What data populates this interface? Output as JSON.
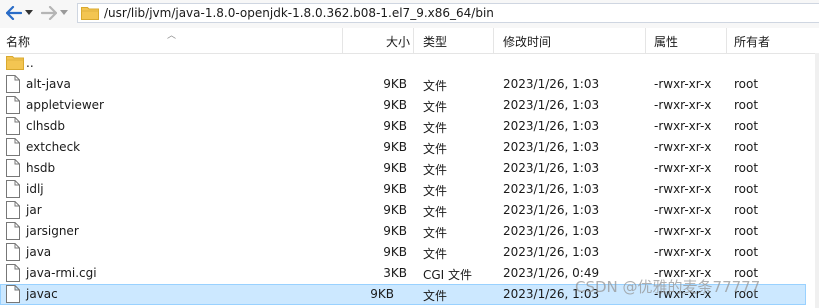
{
  "toolbar": {
    "back_icon": "back-arrow-icon",
    "forward_icon": "forward-arrow-icon",
    "path": "/usr/lib/jvm/java-1.8.0-openjdk-1.8.0.362.b08-1.el7_9.x86_64/bin"
  },
  "columns": {
    "name": "名称",
    "size": "大小",
    "type": "类型",
    "mtime": "修改时间",
    "perm": "属性",
    "owner": "所有者"
  },
  "rows": [
    {
      "name": "..",
      "size": "",
      "type": "",
      "mtime": "",
      "perm": "",
      "owner": "",
      "icon": "folder-up-icon"
    },
    {
      "name": "alt-java",
      "size": "9KB",
      "type": "文件",
      "mtime": "2023/1/26, 1:03",
      "perm": "-rwxr-xr-x",
      "owner": "root",
      "icon": "file-icon"
    },
    {
      "name": "appletviewer",
      "size": "9KB",
      "type": "文件",
      "mtime": "2023/1/26, 1:03",
      "perm": "-rwxr-xr-x",
      "owner": "root",
      "icon": "file-icon"
    },
    {
      "name": "clhsdb",
      "size": "9KB",
      "type": "文件",
      "mtime": "2023/1/26, 1:03",
      "perm": "-rwxr-xr-x",
      "owner": "root",
      "icon": "file-icon"
    },
    {
      "name": "extcheck",
      "size": "9KB",
      "type": "文件",
      "mtime": "2023/1/26, 1:03",
      "perm": "-rwxr-xr-x",
      "owner": "root",
      "icon": "file-icon"
    },
    {
      "name": "hsdb",
      "size": "9KB",
      "type": "文件",
      "mtime": "2023/1/26, 1:03",
      "perm": "-rwxr-xr-x",
      "owner": "root",
      "icon": "file-icon"
    },
    {
      "name": "idlj",
      "size": "9KB",
      "type": "文件",
      "mtime": "2023/1/26, 1:03",
      "perm": "-rwxr-xr-x",
      "owner": "root",
      "icon": "file-icon"
    },
    {
      "name": "jar",
      "size": "9KB",
      "type": "文件",
      "mtime": "2023/1/26, 1:03",
      "perm": "-rwxr-xr-x",
      "owner": "root",
      "icon": "file-icon"
    },
    {
      "name": "jarsigner",
      "size": "9KB",
      "type": "文件",
      "mtime": "2023/1/26, 1:03",
      "perm": "-rwxr-xr-x",
      "owner": "root",
      "icon": "file-icon"
    },
    {
      "name": "java",
      "size": "9KB",
      "type": "文件",
      "mtime": "2023/1/26, 1:03",
      "perm": "-rwxr-xr-x",
      "owner": "root",
      "icon": "file-icon"
    },
    {
      "name": "java-rmi.cgi",
      "size": "3KB",
      "type": "CGI 文件",
      "mtime": "2023/1/26, 0:49",
      "perm": "-rwxr-xr-x",
      "owner": "root",
      "icon": "file-icon"
    },
    {
      "name": "javac",
      "size": "9KB",
      "type": "文件",
      "mtime": "2023/1/26, 1:03",
      "perm": "-rwxr-xr-x",
      "owner": "root",
      "icon": "file-icon",
      "selected": true
    }
  ],
  "watermark": "CSDN @优雅的麦条77777",
  "colors": {
    "selected_bg": "#cce8ff",
    "selected_border": "#99d1ff",
    "folder": "#f3c552",
    "arrow_blue": "#2a6cc7"
  }
}
